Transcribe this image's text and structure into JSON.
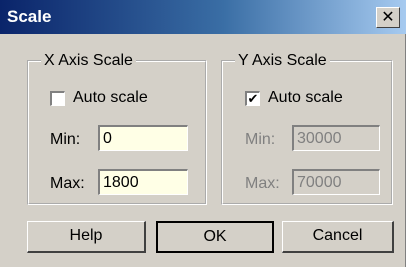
{
  "window": {
    "title": "Scale",
    "close_glyph": "✕"
  },
  "x_axis": {
    "legend": "X Axis Scale",
    "auto_scale_label": "Auto scale",
    "auto_scale_checked": false,
    "min_label": "Min:",
    "min_value": "0",
    "max_label": "Max:",
    "max_value": "1800"
  },
  "y_axis": {
    "legend": "Y Axis Scale",
    "auto_scale_label": "Auto scale",
    "auto_scale_checked": true,
    "check_glyph": "✔",
    "min_label": "Min:",
    "min_value": "30000",
    "max_label": "Max:",
    "max_value": "70000"
  },
  "buttons": {
    "help": "Help",
    "ok": "OK",
    "cancel": "Cancel"
  }
}
